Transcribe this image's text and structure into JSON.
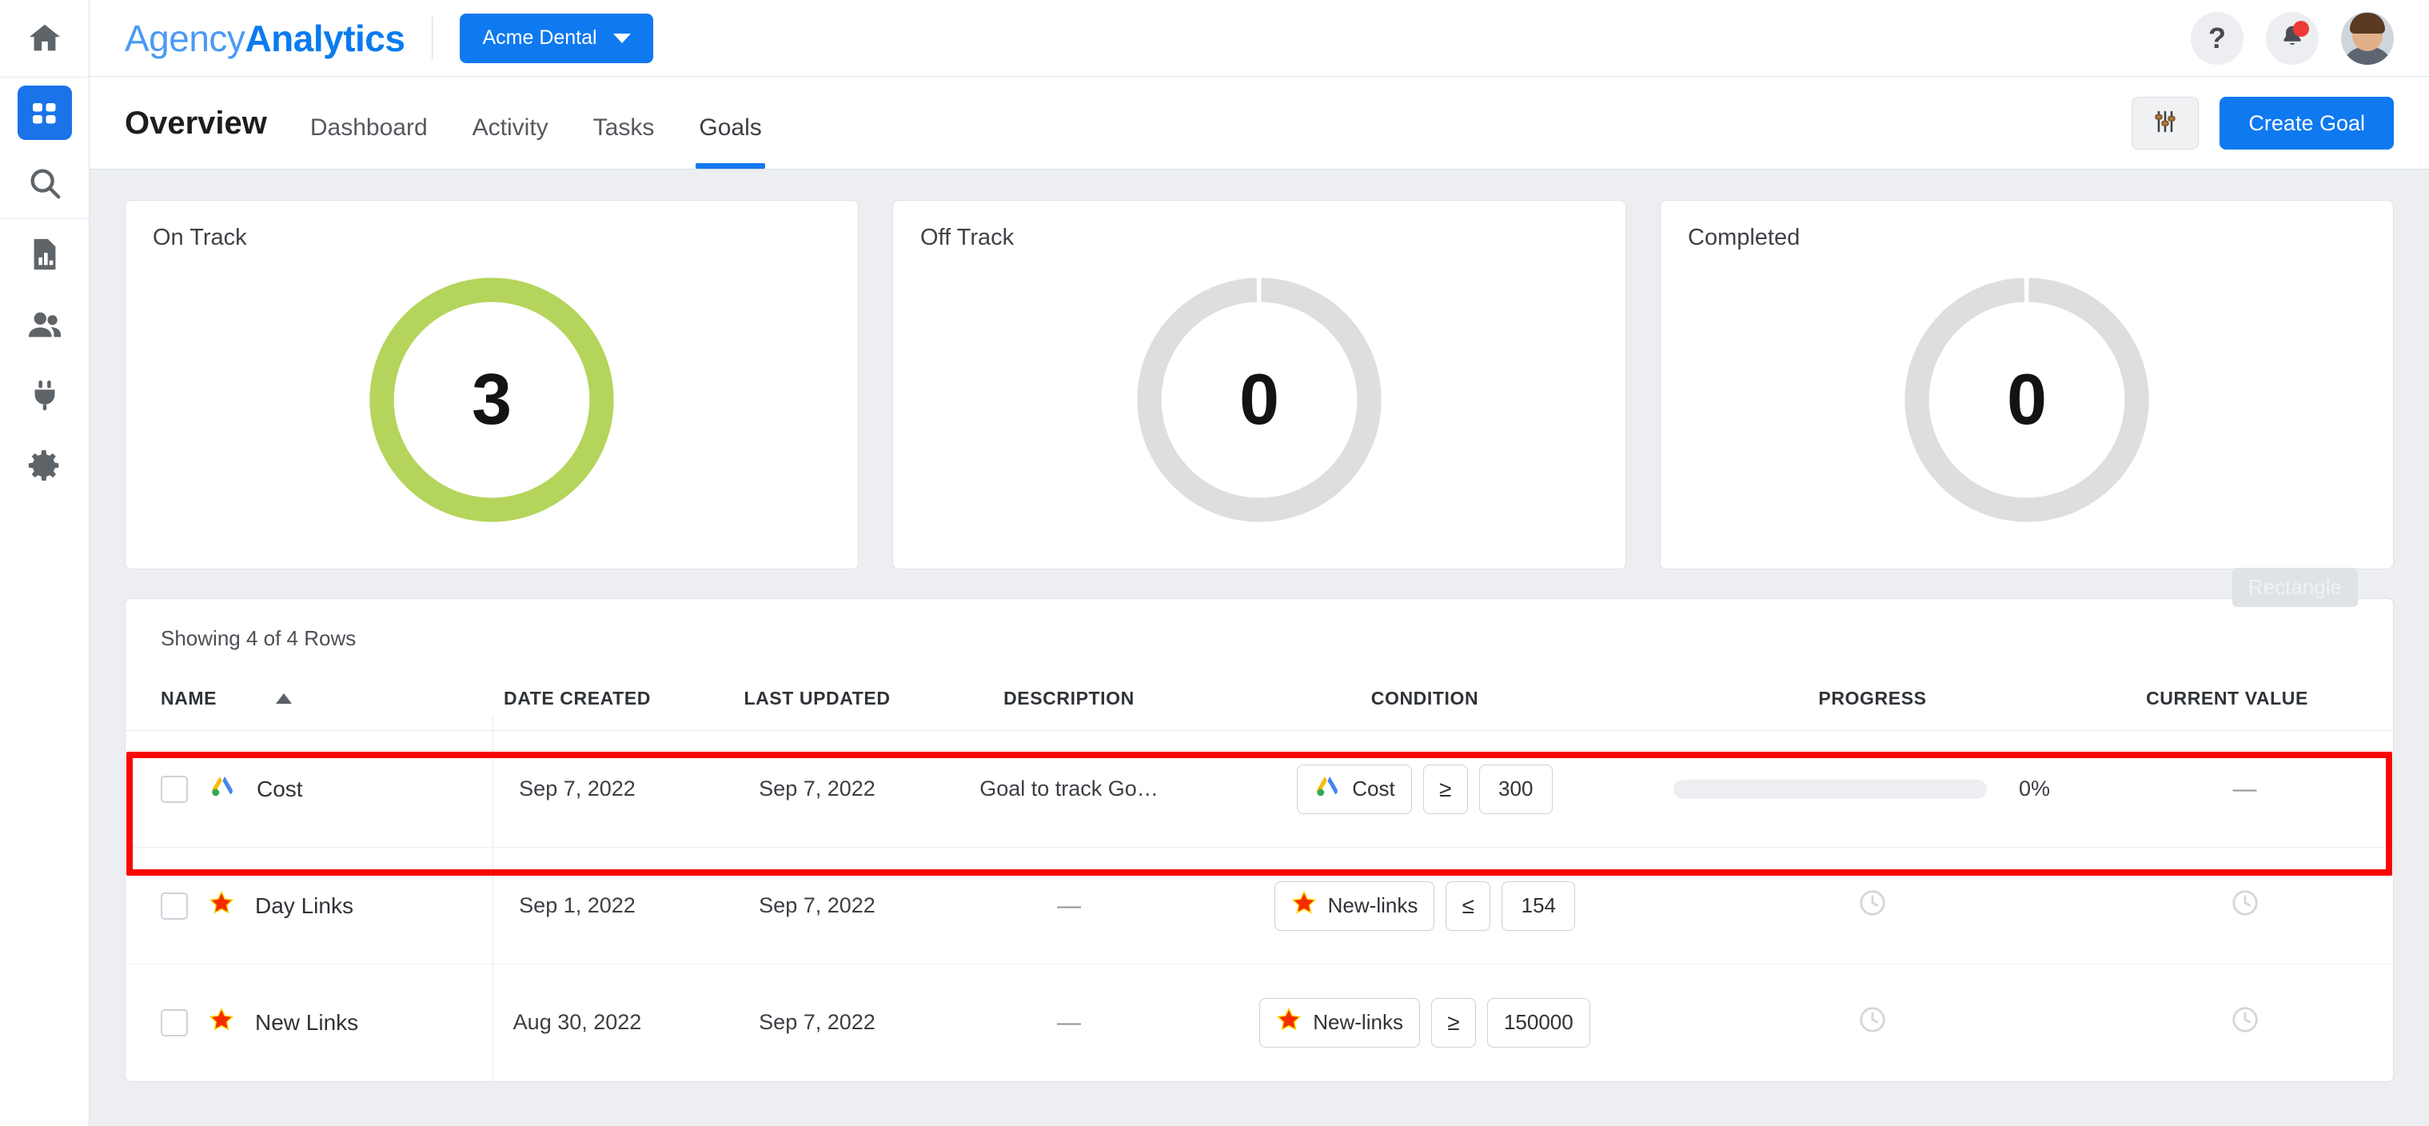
{
  "sidebar": {
    "items": [
      {
        "name": "home",
        "icon": "home-icon",
        "active": false
      },
      {
        "name": "dashboards",
        "icon": "grid-icon",
        "active": true
      },
      {
        "name": "search",
        "icon": "search-icon",
        "active": false
      },
      {
        "name": "reports",
        "icon": "report-document-icon",
        "active": false
      },
      {
        "name": "clients",
        "icon": "users-icon",
        "active": false
      },
      {
        "name": "integrations",
        "icon": "plug-icon",
        "active": false
      },
      {
        "name": "settings",
        "icon": "gear-icon",
        "active": false
      }
    ]
  },
  "topbar": {
    "logo_part1": "Agency",
    "logo_part2": "Analytics",
    "account_label": "Acme Dental",
    "help_label": "?",
    "notifications_icon": "bell-icon",
    "avatar_icon": "user-avatar",
    "accent_color": "#0f79f0"
  },
  "nav": {
    "title": "Overview",
    "tabs": [
      {
        "label": "Dashboard",
        "active": false
      },
      {
        "label": "Activity",
        "active": false
      },
      {
        "label": "Tasks",
        "active": false
      },
      {
        "label": "Goals",
        "active": true
      }
    ],
    "filter_icon": "sliders-icon",
    "create_label": "Create Goal"
  },
  "chart_data": [
    {
      "type": "pie",
      "title": "On Track",
      "values": [
        3
      ],
      "labels": [
        "On Track"
      ],
      "center_value": "3",
      "ring_color": "#b5d45c",
      "filled": true,
      "gap_at_top": false
    },
    {
      "type": "pie",
      "title": "Off Track",
      "values": [
        0
      ],
      "labels": [
        "Off Track"
      ],
      "center_value": "0",
      "ring_color": "#dcdedf",
      "filled": false,
      "gap_at_top": true
    },
    {
      "type": "pie",
      "title": "Completed",
      "values": [
        0
      ],
      "labels": [
        "Completed"
      ],
      "center_value": "0",
      "ring_color": "#dcdedf",
      "filled": false,
      "gap_at_top": true
    }
  ],
  "table": {
    "rowcount_text": "Showing 4 of 4 Rows",
    "sort_column": "NAME",
    "sort_direction": "asc",
    "overlay_label": "Rectangle",
    "highlight_row_index": 0,
    "highlight_color": "#fb0404",
    "columns": [
      "NAME",
      "DATE CREATED",
      "LAST UPDATED",
      "DESCRIPTION",
      "CONDITION",
      "PROGRESS",
      "CURRENT VALUE"
    ],
    "rows": [
      {
        "name": "Cost",
        "icon": "google-ads-icon",
        "date_created": "Sep 7, 2022",
        "last_updated": "Sep 7, 2022",
        "description": "Goal to track Go…",
        "condition_metric": "Cost",
        "condition_icon": "google-ads-icon",
        "condition_operator": "≥",
        "condition_value": "300",
        "progress_type": "bar",
        "progress_pct": "0%",
        "current_value": "—"
      },
      {
        "name": "Day Links",
        "icon": "star-icon",
        "date_created": "Sep 1, 2022",
        "last_updated": "Sep 7, 2022",
        "description": "—",
        "condition_metric": "New-links",
        "condition_icon": "star-icon",
        "condition_operator": "≤",
        "condition_value": "154",
        "progress_type": "pending",
        "progress_pct": "",
        "current_value": "pending"
      },
      {
        "name": "New Links",
        "icon": "star-icon",
        "date_created": "Aug 30, 2022",
        "last_updated": "Sep 7, 2022",
        "description": "—",
        "condition_metric": "New-links",
        "condition_icon": "star-icon",
        "condition_operator": "≥",
        "condition_value": "150000",
        "progress_type": "pending",
        "progress_pct": "",
        "current_value": "pending"
      }
    ]
  }
}
